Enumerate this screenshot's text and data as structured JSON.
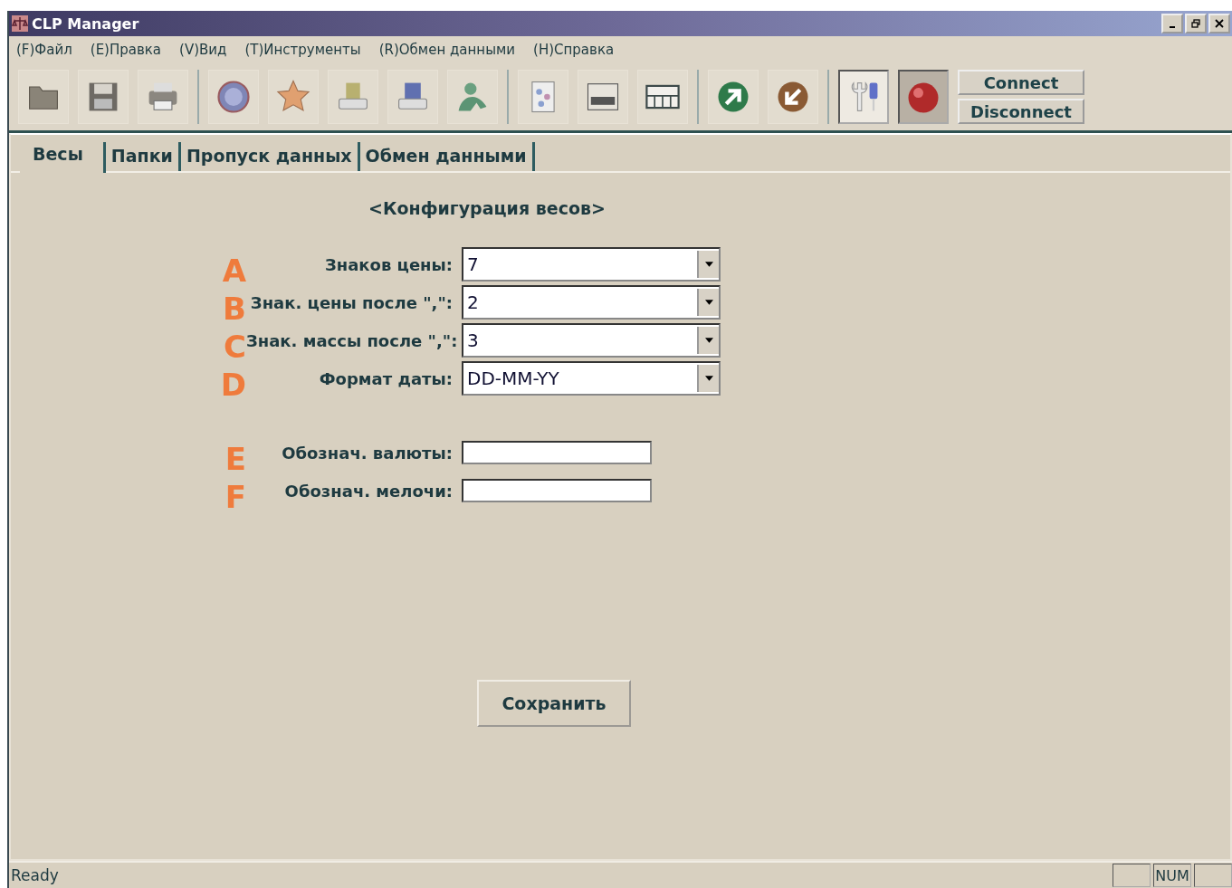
{
  "window": {
    "title": "CLP Manager"
  },
  "menu": [
    "(F)Файл",
    "(E)Правка",
    "(V)Вид",
    "(T)Инструменты",
    "(R)Обмен данными",
    "(H)Справка"
  ],
  "toolbar": {
    "buttons": [
      "Connect",
      "Disconnect"
    ]
  },
  "tabs": [
    {
      "label": "Весы",
      "selected": true
    },
    {
      "label": "Папки",
      "selected": false
    },
    {
      "label": "Пропуск данных",
      "selected": false
    },
    {
      "label": "Обмен данными",
      "selected": false
    }
  ],
  "section_title": "<Конфигурация весов>",
  "fields": [
    {
      "marker": "A",
      "label": "Знаков цены:",
      "kind": "dropdown",
      "value": "7"
    },
    {
      "marker": "B",
      "label": "Знак. цены после \",\":",
      "kind": "dropdown",
      "value": "2"
    },
    {
      "marker": "C",
      "label": "Знак. массы после \",\":",
      "kind": "dropdown",
      "value": "3"
    },
    {
      "marker": "D",
      "label": "Формат даты:",
      "kind": "dropdown",
      "value": "DD-MM-YY"
    },
    {
      "marker": "E",
      "label": "Обознач. валюты:",
      "kind": "text"
    },
    {
      "marker": "F",
      "label": "Обознач. мелочи:",
      "kind": "text"
    }
  ],
  "save_button": "Сохранить",
  "status_bar": {
    "text": "Ready",
    "indicators": [
      "NUM"
    ]
  }
}
